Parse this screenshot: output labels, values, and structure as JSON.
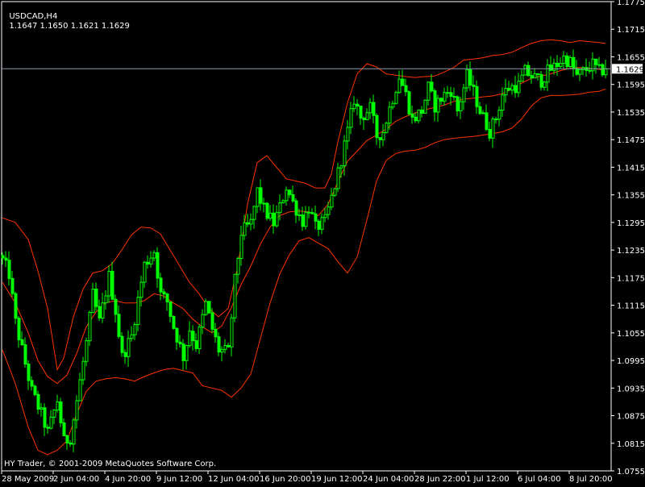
{
  "window": {
    "symbol_tf": "USDCAD,H4",
    "ohlc": "1.1647 1.1650 1.1621 1.1629",
    "copyright": "HY Trader, © 2001-2009 MetaQuotes Software Corp."
  },
  "colors": {
    "background": "#000000",
    "axis": "#ffffff",
    "candle": "#00ff00",
    "band": "#ff3300",
    "bid_line": "#8a9aa8"
  },
  "chart_data": {
    "type": "candlestick",
    "title": "USDCAD,H4",
    "overlay": "Bollinger Bands",
    "y_ticks": [
      "1.1775",
      "1.1715",
      "1.1655",
      "1.1595",
      "1.1535",
      "1.1475",
      "1.1415",
      "1.1355",
      "1.1295",
      "1.1235",
      "1.1175",
      "1.1115",
      "1.1055",
      "1.0995",
      "1.0935",
      "1.0875",
      "1.0815",
      "1.0755"
    ],
    "ylim": [
      1.1755,
      1.1775
    ],
    "x_ticks": [
      "28 May 2009",
      "2 Jun 04:00",
      "4 Jun 20:00",
      "9 Jun 12:00",
      "12 Jun 04:00",
      "16 Jun 20:00",
      "19 Jun 12:00",
      "24 Jun 04:00",
      "28 Jun 22:00",
      "1 Jul 12:00",
      "6 Jul 04:00",
      "8 Jul 20:00"
    ],
    "current_price": "1.1629",
    "close_path": [
      [
        0,
        1.1213
      ],
      [
        2,
        1.1183
      ],
      [
        4,
        1.1078
      ],
      [
        6,
        1.1018
      ],
      [
        9,
        1.0928
      ],
      [
        12,
        1.0878
      ],
      [
        14,
        1.0838
      ],
      [
        17,
        1.0908
      ],
      [
        19,
        1.0818
      ],
      [
        21,
        1.0828
      ],
      [
        23,
        1.0908
      ],
      [
        26,
        1.1033
      ],
      [
        28,
        1.1138
      ],
      [
        30,
        1.1078
      ],
      [
        33,
        1.1178
      ],
      [
        35,
        1.1103
      ],
      [
        37,
        1.1003
      ],
      [
        40,
        1.1048
      ],
      [
        42,
        1.1128
      ],
      [
        44,
        1.1203
      ],
      [
        47,
        1.1233
      ],
      [
        49,
        1.1138
      ],
      [
        51,
        1.1123
      ],
      [
        53,
        1.1068
      ],
      [
        56,
        1.1003
      ],
      [
        58,
        1.1063
      ],
      [
        60,
        1.1028
      ],
      [
        63,
        1.1118
      ],
      [
        65,
        1.1063
      ],
      [
        67,
        1.1018
      ],
      [
        70,
        1.1013
      ],
      [
        72,
        1.1168
      ],
      [
        74,
        1.1273
      ],
      [
        77,
        1.1293
      ],
      [
        79,
        1.1363
      ],
      [
        81,
        1.1323
      ],
      [
        84,
        1.1293
      ],
      [
        86,
        1.1328
      ],
      [
        88,
        1.1373
      ],
      [
        90,
        1.1338
      ],
      [
        93,
        1.1298
      ],
      [
        95,
        1.1328
      ],
      [
        97,
        1.1283
      ],
      [
        100,
        1.1298
      ],
      [
        102,
        1.1348
      ],
      [
        104,
        1.1403
      ],
      [
        107,
        1.1493
      ],
      [
        109,
        1.1563
      ],
      [
        111,
        1.1523
      ],
      [
        114,
        1.1543
      ],
      [
        116,
        1.1483
      ],
      [
        118,
        1.1493
      ],
      [
        120,
        1.1543
      ],
      [
        123,
        1.1613
      ],
      [
        125,
        1.1573
      ],
      [
        127,
        1.1518
      ],
      [
        130,
        1.1538
      ],
      [
        132,
        1.1588
      ],
      [
        134,
        1.1548
      ],
      [
        137,
        1.1573
      ],
      [
        139,
        1.1583
      ],
      [
        141,
        1.1538
      ],
      [
        144,
        1.1613
      ],
      [
        146,
        1.1578
      ],
      [
        148,
        1.1538
      ],
      [
        151,
        1.1493
      ],
      [
        153,
        1.1523
      ],
      [
        155,
        1.1573
      ],
      [
        157,
        1.1588
      ],
      [
        160,
        1.1593
      ],
      [
        162,
        1.1623
      ],
      [
        164,
        1.1613
      ],
      [
        167,
        1.1603
      ],
      [
        169,
        1.1623
      ],
      [
        171,
        1.1633
      ],
      [
        174,
        1.1653
      ],
      [
        176,
        1.1643
      ],
      [
        178,
        1.1613
      ],
      [
        181,
        1.1628
      ],
      [
        183,
        1.1638
      ],
      [
        185,
        1.1623
      ],
      [
        187,
        1.1629
      ]
    ],
    "upper_band": [
      [
        0,
        1.1305
      ],
      [
        4,
        1.1295
      ],
      [
        8,
        1.1258
      ],
      [
        11,
        1.119
      ],
      [
        14,
        1.1108
      ],
      [
        17,
        1.0975
      ],
      [
        19,
        1.1
      ],
      [
        22,
        1.109
      ],
      [
        25,
        1.115
      ],
      [
        28,
        1.1185
      ],
      [
        31,
        1.119
      ],
      [
        34,
        1.1205
      ],
      [
        37,
        1.1235
      ],
      [
        40,
        1.1268
      ],
      [
        43,
        1.1285
      ],
      [
        46,
        1.1283
      ],
      [
        49,
        1.127
      ],
      [
        52,
        1.1235
      ],
      [
        55,
        1.12
      ],
      [
        58,
        1.1165
      ],
      [
        61,
        1.114
      ],
      [
        64,
        1.1108
      ],
      [
        67,
        1.109
      ],
      [
        70,
        1.1108
      ],
      [
        73,
        1.12
      ],
      [
        76,
        1.1335
      ],
      [
        79,
        1.1425
      ],
      [
        82,
        1.144
      ],
      [
        85,
        1.1415
      ],
      [
        88,
        1.139
      ],
      [
        91,
        1.1385
      ],
      [
        94,
        1.138
      ],
      [
        97,
        1.137
      ],
      [
        100,
        1.137
      ],
      [
        102,
        1.14
      ],
      [
        104,
        1.147
      ],
      [
        107,
        1.1555
      ],
      [
        110,
        1.1618
      ],
      [
        113,
        1.164
      ],
      [
        116,
        1.1633
      ],
      [
        119,
        1.1618
      ],
      [
        122,
        1.1615
      ],
      [
        125,
        1.1612
      ],
      [
        128,
        1.161
      ],
      [
        131,
        1.1612
      ],
      [
        134,
        1.1613
      ],
      [
        137,
        1.1622
      ],
      [
        140,
        1.1632
      ],
      [
        143,
        1.1648
      ],
      [
        146,
        1.165
      ],
      [
        149,
        1.1653
      ],
      [
        152,
        1.1658
      ],
      [
        155,
        1.166
      ],
      [
        158,
        1.1665
      ],
      [
        161,
        1.1675
      ],
      [
        164,
        1.1684
      ],
      [
        167,
        1.169
      ],
      [
        170,
        1.1692
      ],
      [
        173,
        1.169
      ],
      [
        176,
        1.1686
      ],
      [
        179,
        1.169
      ],
      [
        182,
        1.1688
      ],
      [
        185,
        1.1686
      ],
      [
        187,
        1.1684
      ]
    ],
    "middle_band": [
      [
        0,
        1.1165
      ],
      [
        4,
        1.112
      ],
      [
        8,
        1.1055
      ],
      [
        11,
        1.0995
      ],
      [
        14,
        1.096
      ],
      [
        17,
        1.0945
      ],
      [
        20,
        1.0963
      ],
      [
        23,
        1.101
      ],
      [
        26,
        1.1068
      ],
      [
        29,
        1.11
      ],
      [
        32,
        1.112
      ],
      [
        35,
        1.1125
      ],
      [
        38,
        1.112
      ],
      [
        41,
        1.112
      ],
      [
        44,
        1.1125
      ],
      [
        47,
        1.114
      ],
      [
        50,
        1.1135
      ],
      [
        53,
        1.112
      ],
      [
        56,
        1.1108
      ],
      [
        59,
        1.1085
      ],
      [
        62,
        1.1068
      ],
      [
        65,
        1.1055
      ],
      [
        68,
        1.107
      ],
      [
        71,
        1.111
      ],
      [
        74,
        1.116
      ],
      [
        77,
        1.12
      ],
      [
        80,
        1.1248
      ],
      [
        83,
        1.1285
      ],
      [
        86,
        1.131
      ],
      [
        89,
        1.1318
      ],
      [
        92,
        1.132
      ],
      [
        95,
        1.1318
      ],
      [
        98,
        1.131
      ],
      [
        101,
        1.1335
      ],
      [
        104,
        1.1383
      ],
      [
        107,
        1.1428
      ],
      [
        110,
        1.145
      ],
      [
        113,
        1.1473
      ],
      [
        116,
        1.1485
      ],
      [
        119,
        1.1498
      ],
      [
        122,
        1.1515
      ],
      [
        125,
        1.1525
      ],
      [
        128,
        1.1533
      ],
      [
        131,
        1.154
      ],
      [
        134,
        1.1545
      ],
      [
        137,
        1.155
      ],
      [
        140,
        1.1558
      ],
      [
        143,
        1.1563
      ],
      [
        146,
        1.1565
      ],
      [
        149,
        1.1568
      ],
      [
        152,
        1.157
      ],
      [
        155,
        1.1575
      ],
      [
        158,
        1.1585
      ],
      [
        161,
        1.1598
      ],
      [
        164,
        1.1608
      ],
      [
        167,
        1.1613
      ],
      [
        170,
        1.1618
      ],
      [
        173,
        1.1625
      ],
      [
        176,
        1.163
      ],
      [
        179,
        1.1632
      ],
      [
        182,
        1.163
      ],
      [
        185,
        1.1628
      ],
      [
        187,
        1.1625
      ]
    ],
    "lower_band": [
      [
        0,
        1.1018
      ],
      [
        4,
        1.0945
      ],
      [
        8,
        1.085
      ],
      [
        11,
        1.08
      ],
      [
        14,
        1.079
      ],
      [
        17,
        1.08
      ],
      [
        20,
        1.082
      ],
      [
        23,
        1.0878
      ],
      [
        26,
        1.0928
      ],
      [
        29,
        1.095
      ],
      [
        32,
        1.0955
      ],
      [
        35,
        1.0958
      ],
      [
        38,
        1.0955
      ],
      [
        41,
        1.095
      ],
      [
        44,
        1.096
      ],
      [
        47,
        1.0968
      ],
      [
        50,
        1.0975
      ],
      [
        53,
        1.0978
      ],
      [
        56,
        1.0973
      ],
      [
        59,
        1.0968
      ],
      [
        62,
        1.094
      ],
      [
        65,
        1.0935
      ],
      [
        68,
        1.093
      ],
      [
        71,
        1.0915
      ],
      [
        74,
        1.0935
      ],
      [
        77,
        1.0965
      ],
      [
        80,
        1.1043
      ],
      [
        83,
        1.112
      ],
      [
        86,
        1.1183
      ],
      [
        89,
        1.1225
      ],
      [
        92,
        1.1255
      ],
      [
        95,
        1.1262
      ],
      [
        98,
        1.125
      ],
      [
        101,
        1.1238
      ],
      [
        104,
        1.121
      ],
      [
        107,
        1.1185
      ],
      [
        110,
        1.122
      ],
      [
        113,
        1.13
      ],
      [
        116,
        1.1385
      ],
      [
        119,
        1.143
      ],
      [
        122,
        1.1445
      ],
      [
        125,
        1.145
      ],
      [
        128,
        1.1452
      ],
      [
        131,
        1.1458
      ],
      [
        134,
        1.1468
      ],
      [
        137,
        1.1475
      ],
      [
        140,
        1.1478
      ],
      [
        143,
        1.148
      ],
      [
        146,
        1.1482
      ],
      [
        149,
        1.1485
      ],
      [
        152,
        1.1488
      ],
      [
        155,
        1.1492
      ],
      [
        158,
        1.15
      ],
      [
        161,
        1.152
      ],
      [
        164,
        1.1548
      ],
      [
        167,
        1.1566
      ],
      [
        170,
        1.1571
      ],
      [
        173,
        1.1571
      ],
      [
        176,
        1.1572
      ],
      [
        179,
        1.1574
      ],
      [
        182,
        1.1578
      ],
      [
        185,
        1.158
      ],
      [
        187,
        1.1585
      ]
    ]
  }
}
